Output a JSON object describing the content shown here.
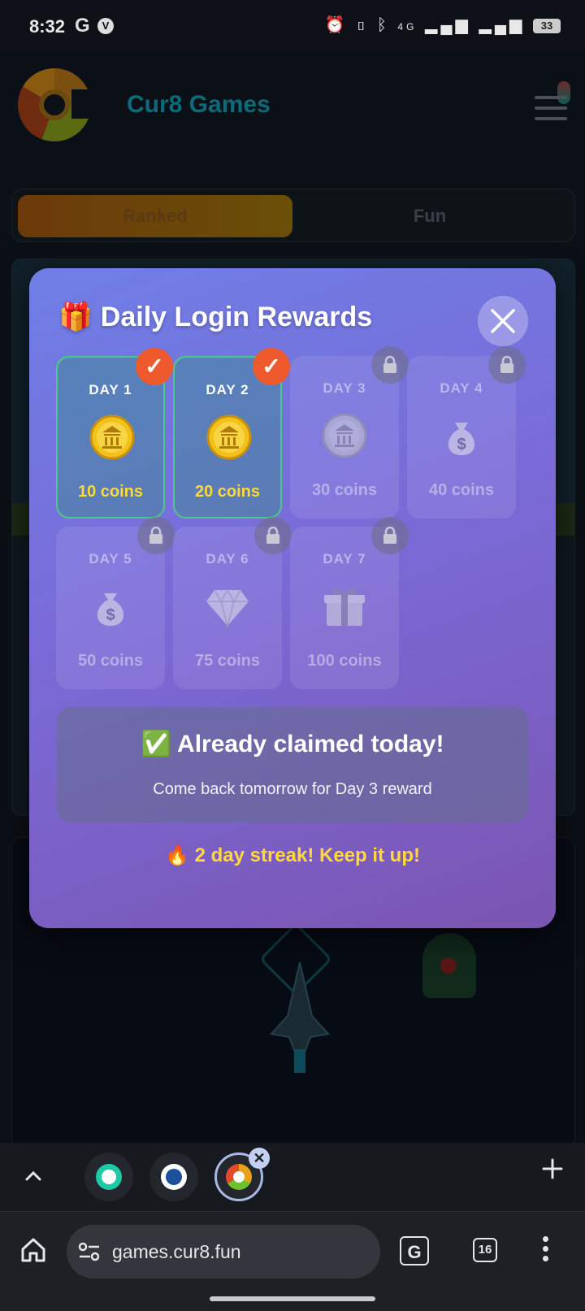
{
  "status_bar": {
    "time": "8:32",
    "g_icon": "G",
    "v_icon": "V",
    "battery": "33",
    "net": "4G"
  },
  "site": {
    "brand": "Cur8 Games"
  },
  "modes": {
    "ranked": "Ranked",
    "fun": "Fun"
  },
  "modal": {
    "title_icon": "🎁",
    "title": "Daily Login Rewards",
    "days": [
      {
        "label": "DAY 1",
        "reward": "10 coins",
        "state": "claimed",
        "icon": "coin-icon"
      },
      {
        "label": "DAY 2",
        "reward": "20 coins",
        "state": "claimed",
        "icon": "coin-icon"
      },
      {
        "label": "DAY 3",
        "reward": "30 coins",
        "state": "locked",
        "icon": "coin-icon"
      },
      {
        "label": "DAY 4",
        "reward": "40 coins",
        "state": "locked",
        "icon": "money-bag-icon"
      },
      {
        "label": "DAY 5",
        "reward": "50 coins",
        "state": "locked",
        "icon": "money-bag-icon"
      },
      {
        "label": "DAY 6",
        "reward": "75 coins",
        "state": "locked",
        "icon": "diamond-icon"
      },
      {
        "label": "DAY 7",
        "reward": "100 coins",
        "state": "locked",
        "icon": "gift-icon"
      }
    ],
    "claimed_title": "✅ Already claimed today!",
    "claimed_sub": "Come back tomorrow for Day 3 reward",
    "streak": "🔥 2 day streak! Keep it up!"
  },
  "browser": {
    "url": "games.cur8.fun",
    "tab_count": "16",
    "translate_label": "G"
  },
  "colors": {
    "modal_start": "#6f7fe6",
    "modal_end": "#7b55b2",
    "claimed_border": "#4fc78c",
    "check_badge": "#ee5a2e",
    "reward_gold": "#ffd93a"
  }
}
